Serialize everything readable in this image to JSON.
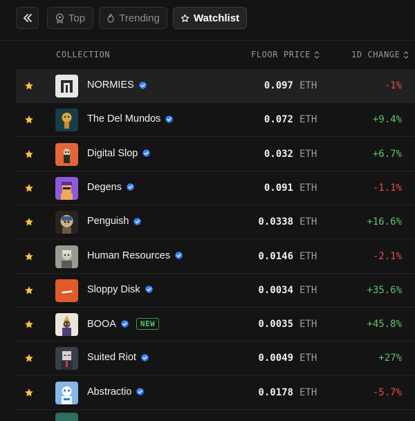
{
  "tabs": [
    {
      "label": "Top",
      "active": false
    },
    {
      "label": "Trending",
      "active": false
    },
    {
      "label": "Watchlist",
      "active": true
    }
  ],
  "table": {
    "headers": {
      "collection": "COLLECTION",
      "floor_price": "FLOOR PRICE",
      "change": "1D CHANGE"
    },
    "rows": [
      {
        "name": "NORMIES",
        "price": "0.097",
        "unit": "ETH",
        "change": "-1%",
        "direction": "neg",
        "badge": "",
        "thumb": "normies"
      },
      {
        "name": "The Del Mundos",
        "price": "0.072",
        "unit": "ETH",
        "change": "+9.4%",
        "direction": "pos",
        "badge": "",
        "thumb": "delmundos"
      },
      {
        "name": "Digital Slop",
        "price": "0.032",
        "unit": "ETH",
        "change": "+6.7%",
        "direction": "pos",
        "badge": "",
        "thumb": "digitalslop"
      },
      {
        "name": "Degens",
        "price": "0.091",
        "unit": "ETH",
        "change": "-1.1%",
        "direction": "neg",
        "badge": "",
        "thumb": "degens"
      },
      {
        "name": "Penguish",
        "price": "0.0338",
        "unit": "ETH",
        "change": "+16.6%",
        "direction": "pos",
        "badge": "",
        "thumb": "penguish"
      },
      {
        "name": "Human Resources",
        "price": "0.0146",
        "unit": "ETH",
        "change": "-2.1%",
        "direction": "neg",
        "badge": "",
        "thumb": "humanresources"
      },
      {
        "name": "Sloppy Disk",
        "price": "0.0034",
        "unit": "ETH",
        "change": "+35.6%",
        "direction": "pos",
        "badge": "",
        "thumb": "sloppydisk"
      },
      {
        "name": "BOOA",
        "price": "0.0035",
        "unit": "ETH",
        "change": "+45.8%",
        "direction": "pos",
        "badge": "NEW",
        "thumb": "booa"
      },
      {
        "name": "Suited Riot",
        "price": "0.0049",
        "unit": "ETH",
        "change": "+27%",
        "direction": "pos",
        "badge": "",
        "thumb": "suitedriot"
      },
      {
        "name": "Abstractio",
        "price": "0.0178",
        "unit": "ETH",
        "change": "-5.7%",
        "direction": "neg",
        "badge": "",
        "thumb": "abstractio"
      }
    ]
  },
  "colors": {
    "positive": "#5ec26a",
    "negative": "#e2504f",
    "star": "#f5c23e",
    "verified": "#3b82f6"
  },
  "icons": {
    "collapse": "chevrons-left-icon",
    "top": "medal-icon",
    "trending": "flame-icon",
    "watchlist": "star-outline-icon",
    "watch": "star-filled-icon",
    "verified": "verified-badge-icon",
    "sort": "sort-updown-icon"
  }
}
